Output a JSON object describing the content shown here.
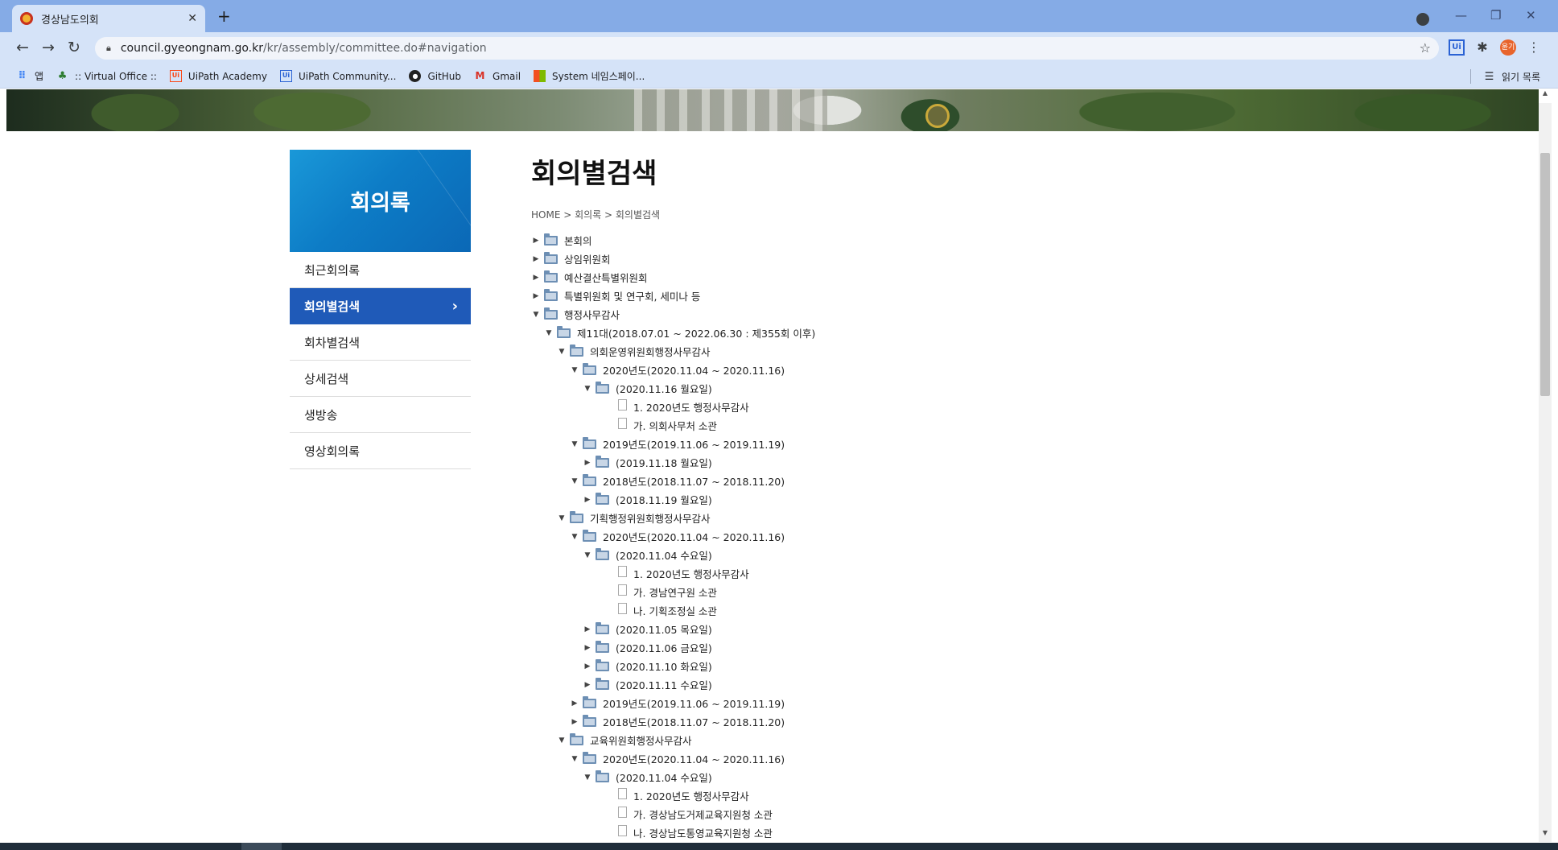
{
  "browser": {
    "tab_title": "경상남도의회",
    "url_domain": "council.gyeongnam.go.kr",
    "url_path": "/kr/assembly/committee.do#navigation",
    "profile_label": "윤기"
  },
  "bookmarks": [
    {
      "icon": "apps-grid-icon",
      "label": "앱"
    },
    {
      "icon": "virtual-office-icon",
      "label": ":: Virtual Office ::"
    },
    {
      "icon": "uipath-icon",
      "label": "UiPath Academy"
    },
    {
      "icon": "uipath-icon",
      "label": "UiPath Community..."
    },
    {
      "icon": "github-icon",
      "label": "GitHub"
    },
    {
      "icon": "gmail-icon",
      "label": "Gmail"
    },
    {
      "icon": "windows-icon",
      "label": "System 네임스페이..."
    }
  ],
  "reading_list": "읽기 목록",
  "sidebar": {
    "title": "회의록",
    "items": [
      {
        "label": "최근회의록",
        "active": false
      },
      {
        "label": "회의별검색",
        "active": true
      },
      {
        "label": "회차별검색",
        "active": false
      },
      {
        "label": "상세검색",
        "active": false
      },
      {
        "label": "생방송",
        "active": false
      },
      {
        "label": "영상회의록",
        "active": false
      }
    ]
  },
  "page": {
    "title": "회의별검색",
    "breadcrumb": "HOME > 회의록 > 회의별검색"
  },
  "tree": [
    {
      "level": 0,
      "state": "collapsed",
      "type": "folder",
      "label": "본회의"
    },
    {
      "level": 0,
      "state": "collapsed",
      "type": "folder",
      "label": "상임위원회"
    },
    {
      "level": 0,
      "state": "collapsed",
      "type": "folder",
      "label": "예산결산특별위원회"
    },
    {
      "level": 0,
      "state": "collapsed",
      "type": "folder",
      "label": "특별위원회 및 연구회, 세미나 등"
    },
    {
      "level": 0,
      "state": "expanded",
      "type": "folder",
      "label": "행정사무감사"
    },
    {
      "level": 1,
      "state": "expanded",
      "type": "folder",
      "label": "제11대(2018.07.01 ~ 2022.06.30 : 제355회 이후)"
    },
    {
      "level": 2,
      "state": "expanded",
      "type": "folder",
      "label": "의회운영위원회행정사무감사"
    },
    {
      "level": 3,
      "state": "expanded",
      "type": "folder",
      "label": "2020년도(2020.11.04 ~ 2020.11.16)"
    },
    {
      "level": 4,
      "state": "expanded",
      "type": "folder",
      "label": "(2020.11.16 월요일)"
    },
    {
      "level": 5,
      "state": "leaf",
      "type": "file",
      "label": "1. 2020년도 행정사무감사"
    },
    {
      "level": 5,
      "state": "leaf",
      "type": "file",
      "label": "가. 의회사무처 소관"
    },
    {
      "level": 3,
      "state": "expanded",
      "type": "folder",
      "label": "2019년도(2019.11.06 ~ 2019.11.19)"
    },
    {
      "level": 4,
      "state": "collapsed",
      "type": "folder",
      "label": "(2019.11.18 월요일)"
    },
    {
      "level": 3,
      "state": "expanded",
      "type": "folder",
      "label": "2018년도(2018.11.07 ~ 2018.11.20)"
    },
    {
      "level": 4,
      "state": "collapsed",
      "type": "folder",
      "label": "(2018.11.19 월요일)"
    },
    {
      "level": 2,
      "state": "expanded",
      "type": "folder",
      "label": "기획행정위원회행정사무감사"
    },
    {
      "level": 3,
      "state": "expanded",
      "type": "folder",
      "label": "2020년도(2020.11.04 ~ 2020.11.16)"
    },
    {
      "level": 4,
      "state": "expanded",
      "type": "folder",
      "label": "(2020.11.04 수요일)"
    },
    {
      "level": 5,
      "state": "leaf",
      "type": "file",
      "label": "1. 2020년도 행정사무감사"
    },
    {
      "level": 5,
      "state": "leaf",
      "type": "file",
      "label": "가. 경남연구원 소관"
    },
    {
      "level": 5,
      "state": "leaf",
      "type": "file",
      "label": "나. 기획조정실 소관"
    },
    {
      "level": 4,
      "state": "collapsed",
      "type": "folder",
      "label": "(2020.11.05 목요일)"
    },
    {
      "level": 4,
      "state": "collapsed",
      "type": "folder",
      "label": "(2020.11.06 금요일)"
    },
    {
      "level": 4,
      "state": "collapsed",
      "type": "folder",
      "label": "(2020.11.10 화요일)"
    },
    {
      "level": 4,
      "state": "collapsed",
      "type": "folder",
      "label": "(2020.11.11 수요일)"
    },
    {
      "level": 3,
      "state": "collapsed",
      "type": "folder",
      "label": "2019년도(2019.11.06 ~ 2019.11.19)"
    },
    {
      "level": 3,
      "state": "collapsed",
      "type": "folder",
      "label": "2018년도(2018.11.07 ~ 2018.11.20)"
    },
    {
      "level": 2,
      "state": "expanded",
      "type": "folder",
      "label": "교육위원회행정사무감사"
    },
    {
      "level": 3,
      "state": "expanded",
      "type": "folder",
      "label": "2020년도(2020.11.04 ~ 2020.11.16)"
    },
    {
      "level": 4,
      "state": "expanded",
      "type": "folder",
      "label": "(2020.11.04 수요일)"
    },
    {
      "level": 5,
      "state": "leaf",
      "type": "file",
      "label": "1. 2020년도 행정사무감사"
    },
    {
      "level": 5,
      "state": "leaf",
      "type": "file",
      "label": "가. 경상남도거제교육지원청 소관"
    },
    {
      "level": 5,
      "state": "leaf",
      "type": "file",
      "label": "나. 경상남도통영교육지원청 소관"
    }
  ],
  "colors": {
    "active_menu": "#1f5ab8",
    "sidebar_header": "#0d7cc6",
    "browser_frame": "#85abe6",
    "toolbar": "#d5e3f8"
  }
}
